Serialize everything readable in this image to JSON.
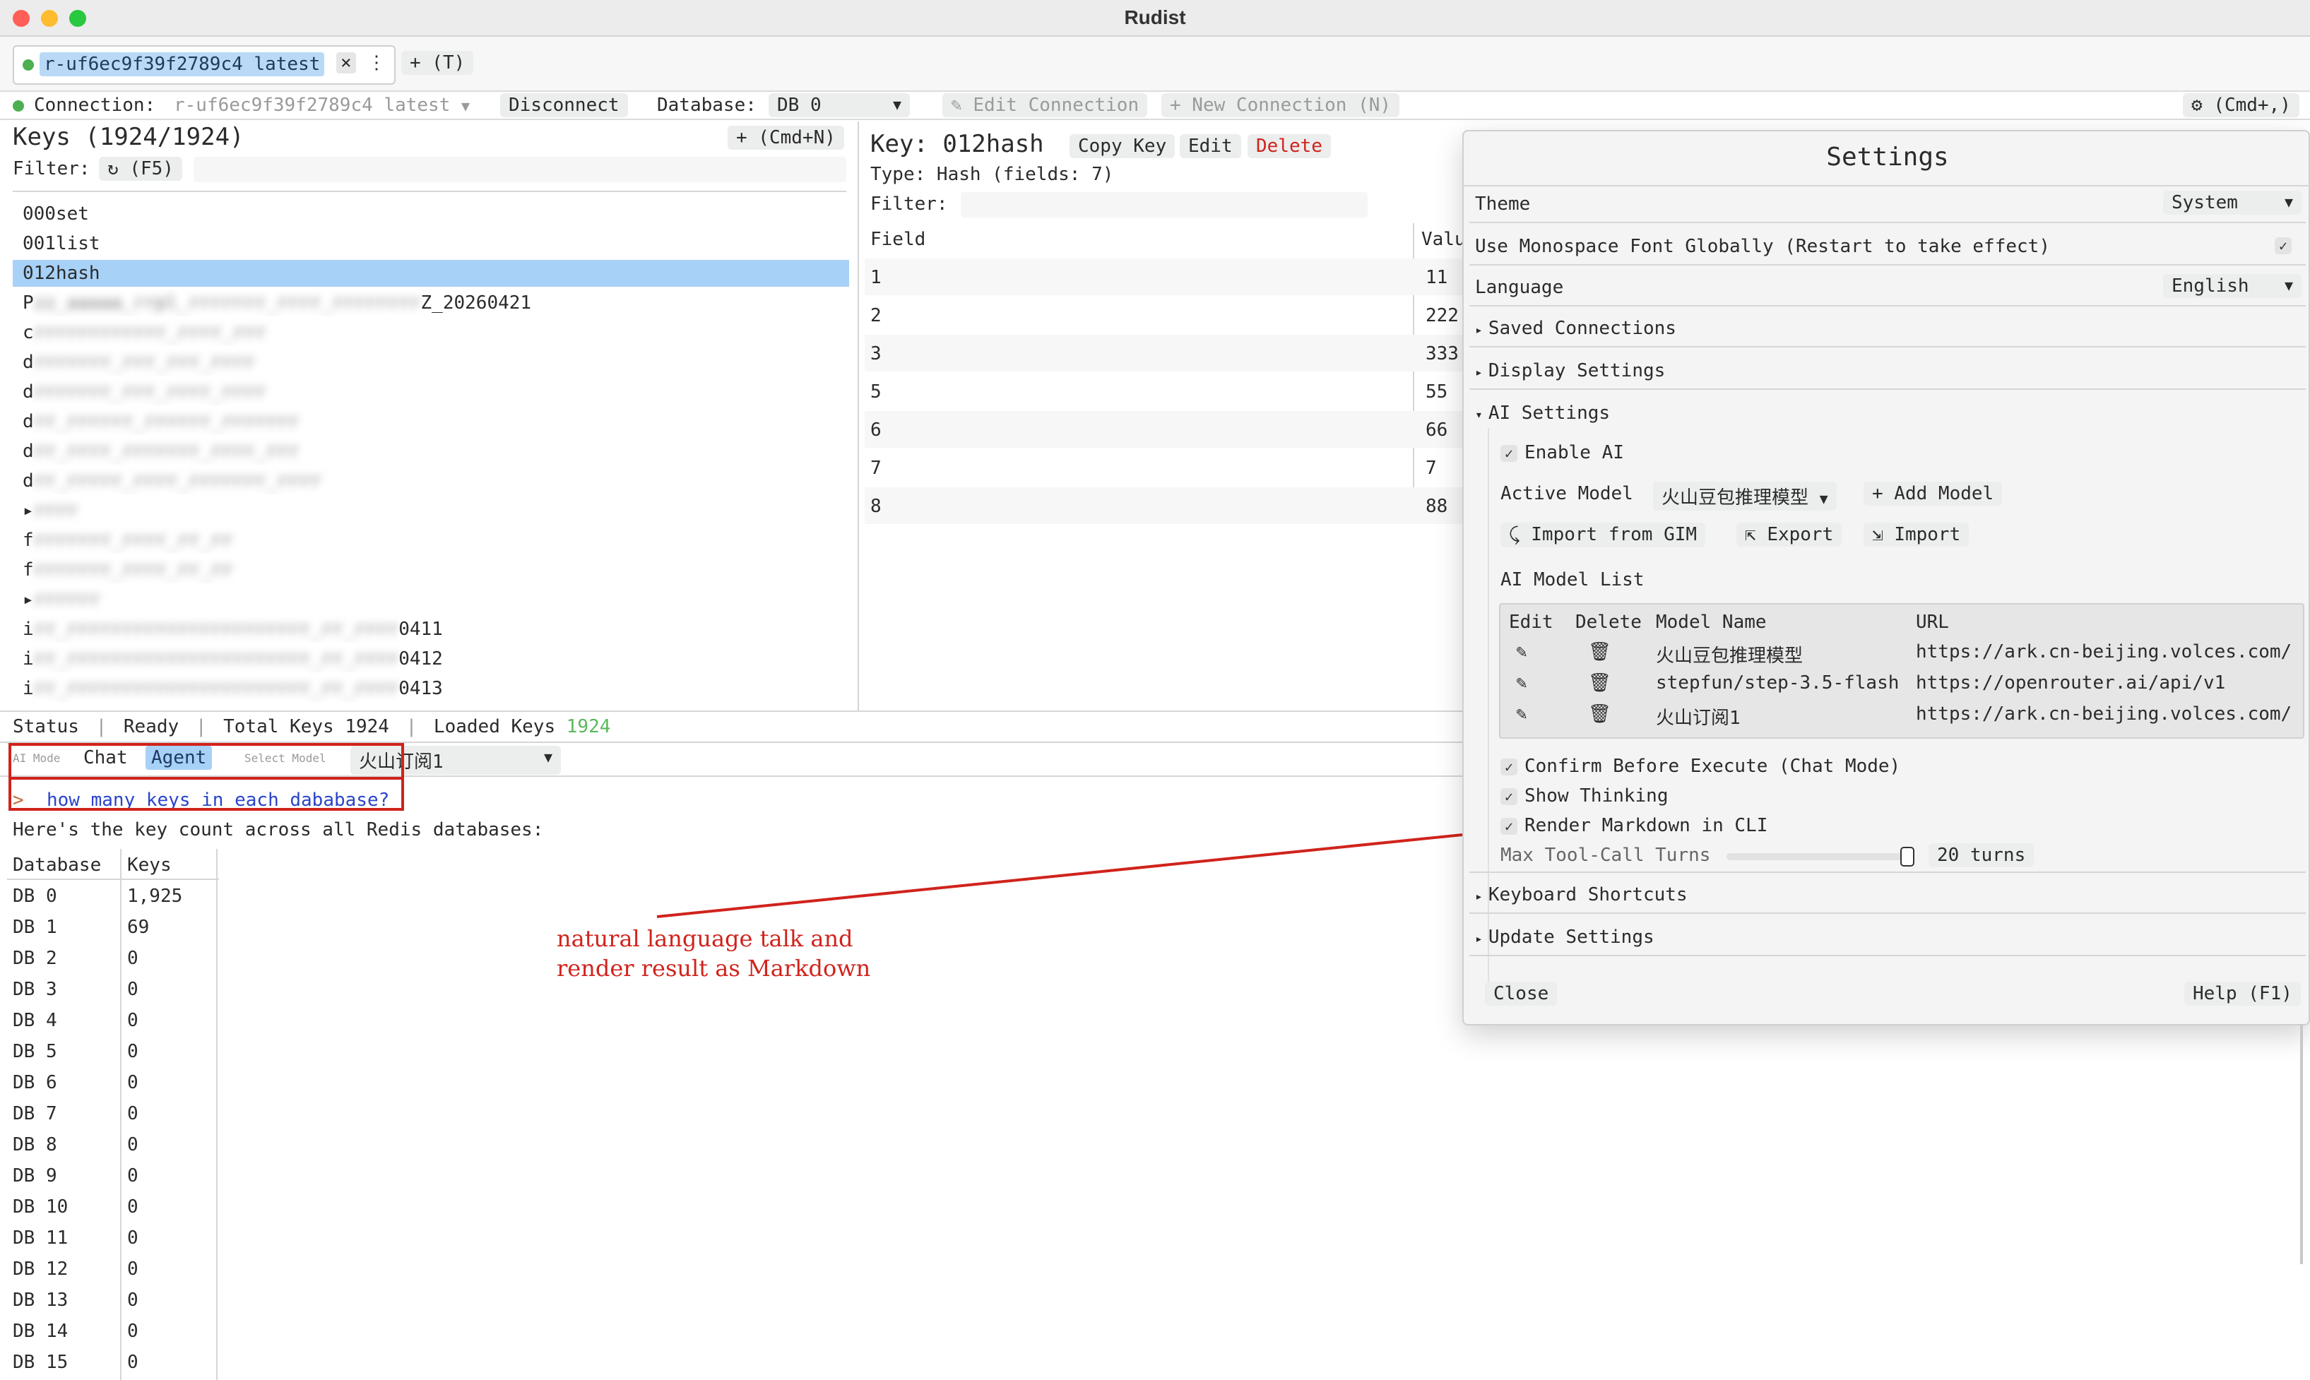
{
  "window": {
    "title": "Rudist"
  },
  "tabs": [
    {
      "label": "r-uf6ec9f39f2789c4 latest",
      "close": "×",
      "menu": "⋮"
    }
  ],
  "new_tab": "+ (T)",
  "toolbar": {
    "connection_label": "Connection:",
    "connection_value": "r-uf6ec9f39f2789c4 latest",
    "disconnect": "Disconnect",
    "database_label": "Database:",
    "database_value": "DB 0",
    "edit_connection": "Edit Connection",
    "new_connection": "+ New Connection (N)",
    "settings_shortcut": "(Cmd+,)"
  },
  "keys_panel": {
    "title": "Keys (1924/1924)",
    "add_button": "+  (Cmd+N)",
    "filter_label": "Filter:",
    "refresh": "(F5)",
    "items": [
      {
        "text": "000set",
        "blurred": ""
      },
      {
        "text": "001list",
        "blurred": ""
      },
      {
        "text": "012hash",
        "blurred": "",
        "selected": true
      },
      {
        "text": "P",
        "blurred": "zz_aaaaa_rrpl_rrrrrrr_rrrr_rrrrrrrr",
        "suffix": "Z_20260421"
      },
      {
        "text": "c",
        "blurred": "rrrrrrrrrrrr_rrrr_rrr",
        "suffix": ""
      },
      {
        "text": "d",
        "blurred": "rrrrrrr_rrr_rrr_rrrr",
        "suffix": ""
      },
      {
        "text": "d",
        "blurred": "rrrrrrr_rrr_rrrr_rrrr",
        "suffix": ""
      },
      {
        "text": "d",
        "blurred": "rr_rrrrrr_rrrrrr_rrrrrrr",
        "suffix": ""
      },
      {
        "text": "d",
        "blurred": "rr_rrrr_rrrrrrr_rrrr_rrr",
        "suffix": ""
      },
      {
        "text": "d",
        "blurred": "rr_rrrrr_rrrr_rrrrrrr_rrrr",
        "suffix": ""
      },
      {
        "text": "▸",
        "blurred": "rrrr",
        "suffix": ""
      },
      {
        "text": "f",
        "blurred": "rrrrrrr_rrrr_rr_rr",
        "suffix": ""
      },
      {
        "text": "f",
        "blurred": "rrrrrrr_rrrr_rr_rr",
        "suffix": ""
      },
      {
        "text": "▸",
        "blurred": "rrrrrr",
        "suffix": ""
      },
      {
        "text": "i",
        "blurred": "rr_rrrrrrrrrrrrrrrrrrrrrr_rr_rrrr",
        "suffix": "0411"
      },
      {
        "text": "i",
        "blurred": "rr_rrrrrrrrrrrrrrrrrrrrrr_rr_rrrr",
        "suffix": "0412"
      },
      {
        "text": "i",
        "blurred": "rr_rrrrrrrrrrrrrrrrrrrrrr_rr_rrrr",
        "suffix": "0413"
      }
    ]
  },
  "key_detail": {
    "title": "Key: 012hash",
    "copy_key": "Copy Key",
    "edit": "Edit",
    "delete": "Delete",
    "type_info": "Type: Hash (fields: 7)",
    "filter_label": "Filter:",
    "columns": [
      "Field",
      "Valu"
    ],
    "rows": [
      {
        "field": "1",
        "value": "11"
      },
      {
        "field": "2",
        "value": "222"
      },
      {
        "field": "3",
        "value": "333"
      },
      {
        "field": "5",
        "value": "55"
      },
      {
        "field": "6",
        "value": "66"
      },
      {
        "field": "7",
        "value": "7"
      },
      {
        "field": "8",
        "value": "88"
      }
    ]
  },
  "status_bar": {
    "status_label": "Status",
    "status_value": "Ready",
    "total_keys": "Total Keys 1924",
    "loaded_label": "Loaded Keys",
    "loaded_value": "1924",
    "loaded_color": "#5cb85c"
  },
  "ai_bar": {
    "mode_label": "AI Mode",
    "chat": "Chat",
    "agent": "Agent",
    "select_model_label": "Select Model",
    "model_value": "火山订阅1"
  },
  "chat": {
    "prompt_symbol": ">",
    "query": "how many keys in each dababase?",
    "answer_intro": "Here's the key count across all Redis databases:",
    "table_headers": [
      "Database",
      "Keys"
    ],
    "table_rows": [
      {
        "db": "DB 0",
        "keys": "1,925"
      },
      {
        "db": "DB 1",
        "keys": "69"
      },
      {
        "db": "DB 2",
        "keys": "0"
      },
      {
        "db": "DB 3",
        "keys": "0"
      },
      {
        "db": "DB 4",
        "keys": "0"
      },
      {
        "db": "DB 5",
        "keys": "0"
      },
      {
        "db": "DB 6",
        "keys": "0"
      },
      {
        "db": "DB 7",
        "keys": "0"
      },
      {
        "db": "DB 8",
        "keys": "0"
      },
      {
        "db": "DB 9",
        "keys": "0"
      },
      {
        "db": "DB 10",
        "keys": "0"
      },
      {
        "db": "DB 11",
        "keys": "0"
      },
      {
        "db": "DB 12",
        "keys": "0"
      },
      {
        "db": "DB 13",
        "keys": "0"
      },
      {
        "db": "DB 14",
        "keys": "0"
      },
      {
        "db": "DB 15",
        "keys": "0"
      }
    ]
  },
  "annotation": {
    "line1": "natural language talk and",
    "line2": "render result as Markdown",
    "color": "#d0231c"
  },
  "settings": {
    "title": "Settings",
    "theme_label": "Theme",
    "theme_value": "System",
    "monospace_label": "Use Monospace Font Globally (Restart to take effect)",
    "language_label": "Language",
    "language_value": "English",
    "saved_connections": "Saved Connections",
    "display_settings": "Display Settings",
    "ai_settings": "AI Settings",
    "enable_ai": "Enable AI",
    "active_model_label": "Active Model",
    "active_model_value": "火山豆包推理模型",
    "add_model": "+ Add Model",
    "import_gim": "Import from GIM",
    "export": "Export",
    "import": "Import",
    "model_list_title": "AI Model List",
    "model_columns": [
      "Edit",
      "Delete",
      "Model Name",
      "URL"
    ],
    "models": [
      {
        "name": "火山豆包推理模型",
        "url": "https://ark.cn-beijing.volces.com/"
      },
      {
        "name": "stepfun/step-3.5-flash",
        "url": "https://openrouter.ai/api/v1"
      },
      {
        "name": "火山订阅1",
        "url": "https://ark.cn-beijing.volces.com/"
      }
    ],
    "confirm_execute": "Confirm Before Execute (Chat Mode)",
    "show_thinking": "Show Thinking",
    "render_markdown": "Render Markdown in CLI",
    "max_turns_label": "Max Tool-Call Turns",
    "max_turns_value": "20 turns",
    "keyboard_shortcuts": "Keyboard Shortcuts",
    "update_settings": "Update Settings",
    "close": "Close",
    "help": "Help (F1)"
  }
}
